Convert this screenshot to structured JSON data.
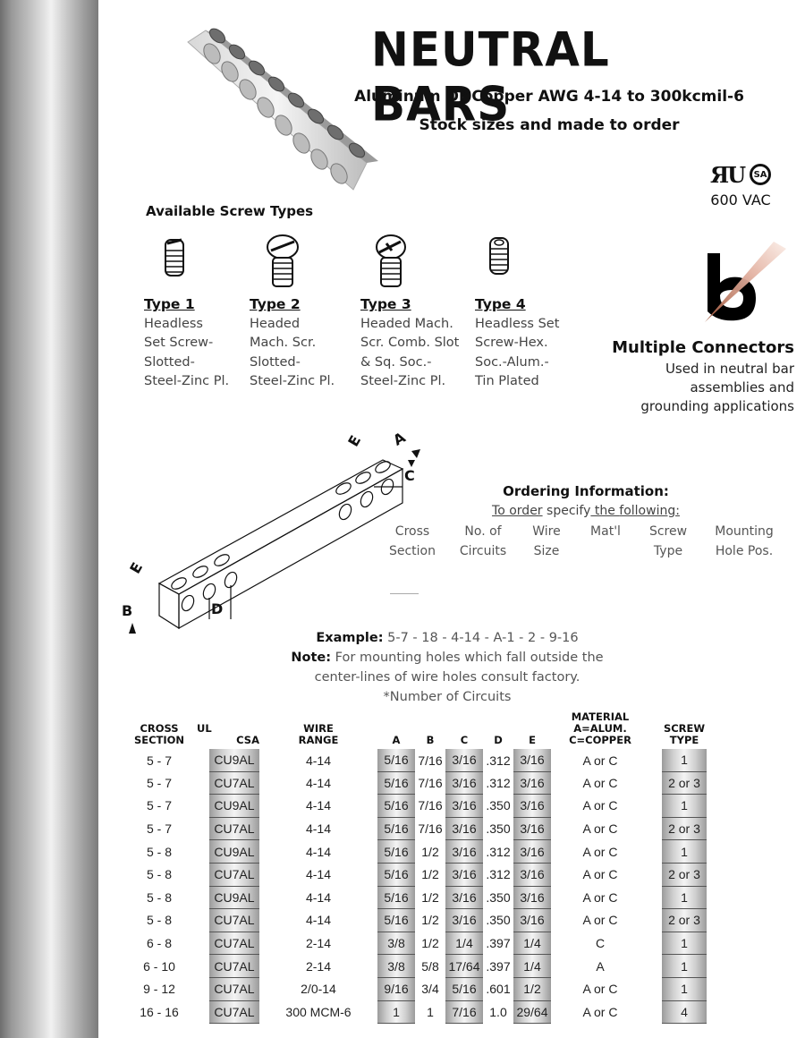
{
  "header": {
    "title": "NEUTRAL BARS",
    "subtitle_line1": "Aluminum Or Copper AWG 4-14 to 300kcmil-6",
    "subtitle_line2": "Stock sizes and made to order"
  },
  "certifications": {
    "ul_mark": "ЯU",
    "csa_mark": "SA",
    "voltage": "600 VAC"
  },
  "screw_types": {
    "heading": "Available Screw Types",
    "items": [
      {
        "name": "Type 1",
        "lines": [
          "Headless",
          "Set Screw-",
          "Slotted-",
          "Steel-Zinc Pl."
        ]
      },
      {
        "name": "Type 2",
        "lines": [
          "Headed",
          "Mach. Scr.",
          "Slotted-",
          "Steel-Zinc Pl."
        ]
      },
      {
        "name": "Type 3",
        "lines": [
          "Headed Mach.",
          "Scr. Comb. Slot",
          "& Sq. Soc.-",
          "Steel-Zinc Pl."
        ]
      },
      {
        "name": "Type 4",
        "lines": [
          "Headless Set",
          "Screw-Hex.",
          "Soc.-Alum.-",
          "Tin Plated"
        ]
      }
    ]
  },
  "multiple_connectors": {
    "title": "Multiple Connectors",
    "desc_lines": [
      "Used in neutral bar",
      "assemblies and",
      "grounding applications"
    ]
  },
  "diagram": {
    "labels": {
      "a": "A",
      "b": "B",
      "c": "C",
      "d": "D",
      "e": "E"
    }
  },
  "ordering": {
    "title": "Ordering Information:",
    "instruction_parts": [
      "To order",
      " specify",
      " the ",
      "following:"
    ],
    "columns": [
      {
        "line1": "Cross",
        "line2": "Section"
      },
      {
        "line1": "No. of",
        "line2": "Circuits"
      },
      {
        "line1": "Wire",
        "line2": "Size"
      },
      {
        "line1": "Mat'l",
        "line2": ""
      },
      {
        "line1": "Screw",
        "line2": "Type"
      },
      {
        "line1": "Mounting",
        "line2": "Hole Pos."
      }
    ]
  },
  "example": {
    "label": "Example:",
    "value": " 5-7 - 18 - 4-14 - A-1 - 2 - 9-16",
    "note_label": "Note:",
    "note_text": " For mounting holes which fall outside the",
    "note_text2": "center-lines of wire holes consult factory.",
    "footnote": "*Number of Circuits"
  },
  "table": {
    "headers": {
      "cross_section": [
        "CROSS",
        "SECTION"
      ],
      "ul": "UL",
      "csa": "CSA",
      "wire_range": [
        "WIRE",
        "RANGE"
      ],
      "a": "A",
      "b": "B",
      "c": "C",
      "d": "D",
      "e": "E",
      "material": [
        "MATERIAL",
        "A=ALUM.",
        "C=COPPER"
      ],
      "screw_type": [
        "SCREW",
        "TYPE"
      ]
    },
    "rows": [
      {
        "cross": "5 - 7",
        "ulcsa": "CU9AL",
        "wire": "4-14",
        "a": "5/16",
        "b": "7/16",
        "c": "3/16",
        "d": ".312",
        "e": "3/16",
        "mat": "A or C",
        "screw": "1"
      },
      {
        "cross": "5 - 7",
        "ulcsa": "CU7AL",
        "wire": "4-14",
        "a": "5/16",
        "b": "7/16",
        "c": "3/16",
        "d": ".312",
        "e": "3/16",
        "mat": "A or C",
        "screw": "2 or 3"
      },
      {
        "cross": "5 - 7",
        "ulcsa": "CU9AL",
        "wire": "4-14",
        "a": "5/16",
        "b": "7/16",
        "c": "3/16",
        "d": ".350",
        "e": "3/16",
        "mat": "A or C",
        "screw": "1"
      },
      {
        "cross": "5 - 7",
        "ulcsa": "CU7AL",
        "wire": "4-14",
        "a": "5/16",
        "b": "7/16",
        "c": "3/16",
        "d": ".350",
        "e": "3/16",
        "mat": "A or C",
        "screw": "2 or 3"
      },
      {
        "cross": "5 - 8",
        "ulcsa": "CU9AL",
        "wire": "4-14",
        "a": "5/16",
        "b": "1/2",
        "c": "3/16",
        "d": ".312",
        "e": "3/16",
        "mat": "A or C",
        "screw": "1"
      },
      {
        "cross": "5 - 8",
        "ulcsa": "CU7AL",
        "wire": "4-14",
        "a": "5/16",
        "b": "1/2",
        "c": "3/16",
        "d": ".312",
        "e": "3/16",
        "mat": "A or C",
        "screw": "2 or 3"
      },
      {
        "cross": "5 - 8",
        "ulcsa": "CU9AL",
        "wire": "4-14",
        "a": "5/16",
        "b": "1/2",
        "c": "3/16",
        "d": ".350",
        "e": "3/16",
        "mat": "A or C",
        "screw": "1"
      },
      {
        "cross": "5 - 8",
        "ulcsa": "CU7AL",
        "wire": "4-14",
        "a": "5/16",
        "b": "1/2",
        "c": "3/16",
        "d": ".350",
        "e": "3/16",
        "mat": "A or C",
        "screw": "2 or 3"
      },
      {
        "cross": "6 - 8",
        "ulcsa": "CU7AL",
        "wire": "2-14",
        "a": "3/8",
        "b": "1/2",
        "c": "1/4",
        "d": ".397",
        "e": "1/4",
        "mat": "C",
        "screw": "1"
      },
      {
        "cross": "6 - 10",
        "ulcsa": "CU7AL",
        "wire": "2-14",
        "a": "3/8",
        "b": "5/8",
        "c": "17/64",
        "d": ".397",
        "e": "1/4",
        "mat": "A",
        "screw": "1"
      },
      {
        "cross": "9 - 12",
        "ulcsa": "CU7AL",
        "wire": "2/0-14",
        "a": "9/16",
        "b": "3/4",
        "c": "5/16",
        "d": ".601",
        "e": "1/2",
        "mat": "A or C",
        "screw": "1"
      },
      {
        "cross": "16 - 16",
        "ulcsa": "CU7AL",
        "wire": "300 MCM-6",
        "a": "1",
        "b": "1",
        "c": "7/16",
        "d": "1.0",
        "e": "29/64",
        "mat": "A or C",
        "screw": "4"
      }
    ]
  }
}
